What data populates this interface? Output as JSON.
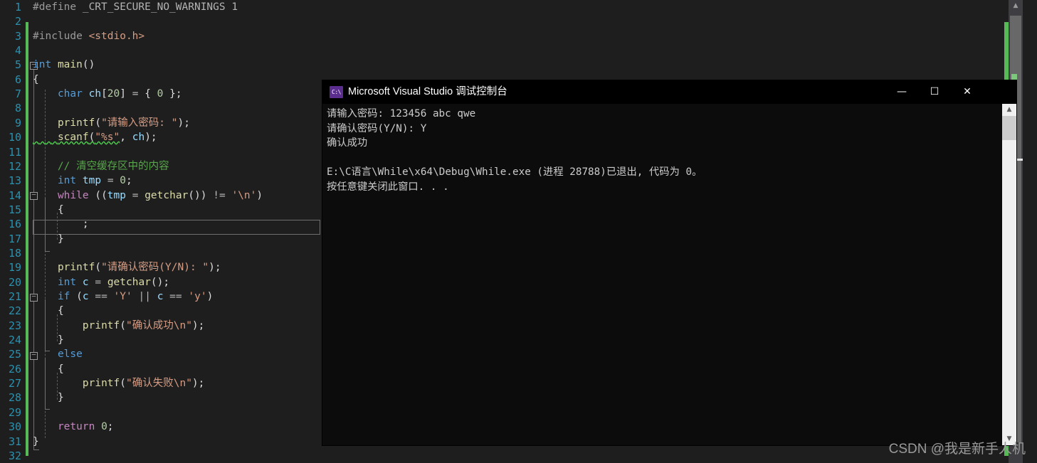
{
  "editor": {
    "current_line": 16,
    "lines": [
      {
        "n": 1,
        "text": "#define _CRT_SECURE_NO_WARNINGS 1"
      },
      {
        "n": 2,
        "text": ""
      },
      {
        "n": 3,
        "text": "#include <stdio.h>"
      },
      {
        "n": 4,
        "text": ""
      },
      {
        "n": 5,
        "text": "int main()"
      },
      {
        "n": 6,
        "text": "{"
      },
      {
        "n": 7,
        "text": "    char ch[20] = { 0 };"
      },
      {
        "n": 8,
        "text": ""
      },
      {
        "n": 9,
        "text": "    printf(\"请输入密码: \");"
      },
      {
        "n": 10,
        "text": "    scanf(\"%s\", ch);"
      },
      {
        "n": 11,
        "text": ""
      },
      {
        "n": 12,
        "text": "    // 清空缓存区中的内容"
      },
      {
        "n": 13,
        "text": "    int tmp = 0;"
      },
      {
        "n": 14,
        "text": "    while ((tmp = getchar()) != '\\n')"
      },
      {
        "n": 15,
        "text": "    {"
      },
      {
        "n": 16,
        "text": "        ;"
      },
      {
        "n": 17,
        "text": "    }"
      },
      {
        "n": 18,
        "text": ""
      },
      {
        "n": 19,
        "text": "    printf(\"请确认密码(Y/N): \");"
      },
      {
        "n": 20,
        "text": "    int c = getchar();"
      },
      {
        "n": 21,
        "text": "    if (c == 'Y' || c == 'y')"
      },
      {
        "n": 22,
        "text": "    {"
      },
      {
        "n": 23,
        "text": "        printf(\"确认成功\\n\");"
      },
      {
        "n": 24,
        "text": "    }"
      },
      {
        "n": 25,
        "text": "    else"
      },
      {
        "n": 26,
        "text": "    {"
      },
      {
        "n": 27,
        "text": "        printf(\"确认失败\\n\");"
      },
      {
        "n": 28,
        "text": "    }"
      },
      {
        "n": 29,
        "text": ""
      },
      {
        "n": 30,
        "text": "    return 0;"
      },
      {
        "n": 31,
        "text": "}"
      },
      {
        "n": 32,
        "text": ""
      }
    ],
    "scrollbar": {
      "up_arrow": "▲"
    }
  },
  "console": {
    "title": "Microsoft Visual Studio 调试控制台",
    "icon": "console-icon",
    "icon_label": "C:\\",
    "buttons": {
      "minimize": "—",
      "maximize": "☐",
      "close": "✕"
    },
    "output": [
      "请输入密码: 123456 abc qwe",
      "请确认密码(Y/N): Y",
      "确认成功",
      "",
      "E:\\C语言\\While\\x64\\Debug\\While.exe (进程 28788)已退出, 代码为 0。",
      "按任意键关闭此窗口. . ."
    ],
    "scrollbar": {
      "up_arrow": "▲",
      "down_arrow": "▼"
    }
  },
  "watermark": "CSDN @我是新手人机"
}
